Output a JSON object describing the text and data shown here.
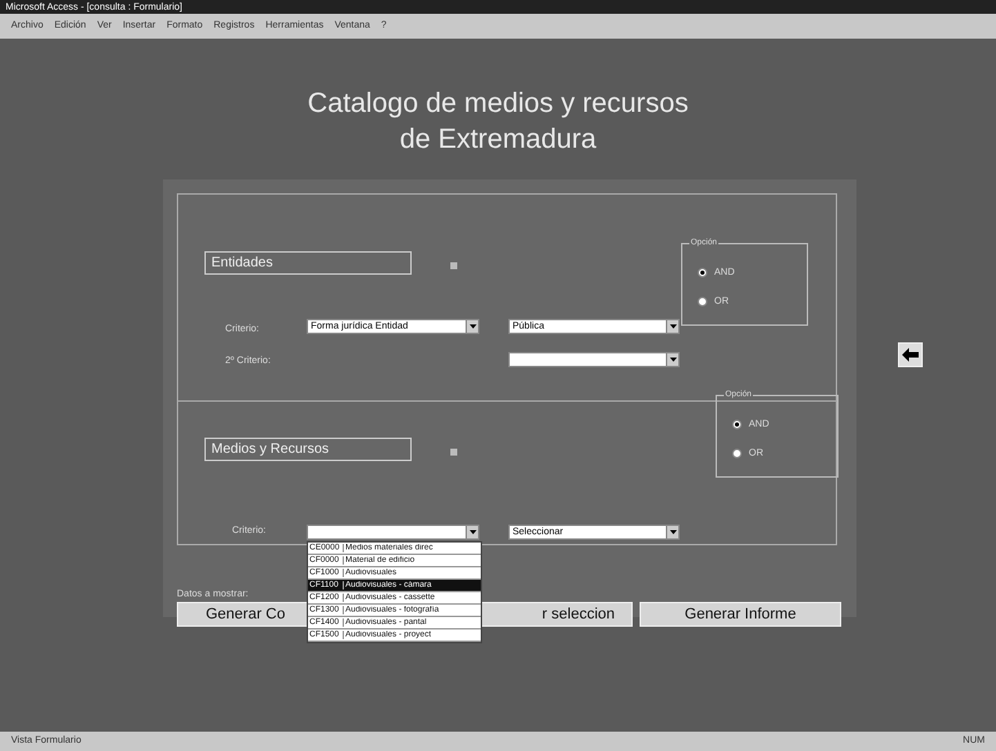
{
  "window": {
    "title": "Microsoft Access - [consulta : Formulario]"
  },
  "menu": [
    "Archivo",
    "Edición",
    "Ver",
    "Insertar",
    "Formato",
    "Registros",
    "Herramientas",
    "Ventana",
    "?"
  ],
  "form": {
    "title_lines": [
      "Catalogo de medios y recursos",
      "de Extremadura"
    ],
    "entities": {
      "label": "Entidades",
      "criteria_label": "Criterio:",
      "criteria_value": "Forma jurídica Entidad",
      "criteria_value_2": "Pública",
      "second_criteria_label": "2º Criterio:",
      "option_group": {
        "label": "Opción",
        "options": [
          {
            "label": "AND",
            "selected": true
          },
          {
            "label": "OR",
            "selected": false
          }
        ]
      }
    },
    "option_group_2": {
      "label": "Opción",
      "options": [
        {
          "label": "AND",
          "selected": true
        },
        {
          "label": "OR",
          "selected": false
        }
      ]
    },
    "resources": {
      "label": "Medios y Recursos",
      "criteria_label": "Criterio:",
      "criteria_value_2": "Seleccionar",
      "dropdown_items": [
        {
          "code": "CE0000",
          "text": "Medios materiales direc",
          "selected": false
        },
        {
          "code": "CF0000",
          "text": "Material de edificio",
          "selected": false
        },
        {
          "code": "CF1000",
          "text": "Audiovisuales",
          "selected": false
        },
        {
          "code": "CF1100",
          "text": "Audiovisuales - cámara",
          "selected": true
        },
        {
          "code": "CF1200",
          "text": "Audiovisuales - cassette",
          "selected": false
        },
        {
          "code": "CF1300",
          "text": "Audiovisuales - fotografía",
          "selected": false
        },
        {
          "code": "CF1400",
          "text": "Audiovisuales - pantal",
          "selected": false
        },
        {
          "code": "CF1500",
          "text": "Audiovisuales - proyect",
          "selected": false
        }
      ]
    },
    "data_label": "Datos a mostrar:",
    "buttons": [
      "Generar Co",
      "r seleccion",
      "Generar Informe"
    ]
  },
  "status_bar": {
    "left": "Vista Formulario",
    "right": "NUM"
  }
}
